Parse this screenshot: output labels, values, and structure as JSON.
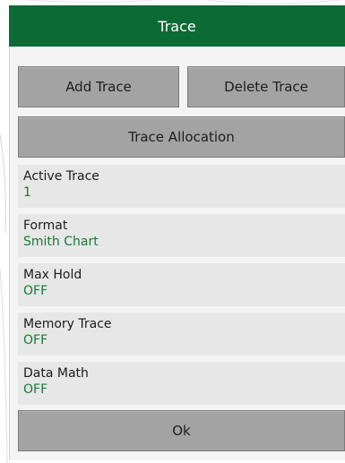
{
  "dialog": {
    "title": "Trace",
    "buttons": {
      "add_trace": "Add Trace",
      "delete_trace": "Delete Trace",
      "trace_allocation": "Trace Allocation",
      "ok": "Ok"
    },
    "items": [
      {
        "label": "Active Trace",
        "value": "1"
      },
      {
        "label": "Format",
        "value": "Smith Chart"
      },
      {
        "label": "Max Hold",
        "value": "OFF"
      },
      {
        "label": "Memory Trace",
        "value": "OFF"
      },
      {
        "label": "Data Math",
        "value": "OFF"
      }
    ]
  },
  "colors": {
    "header_bg": "#0c6a35",
    "value_text": "#147a3c",
    "button_bg": "#a3a3a3"
  }
}
